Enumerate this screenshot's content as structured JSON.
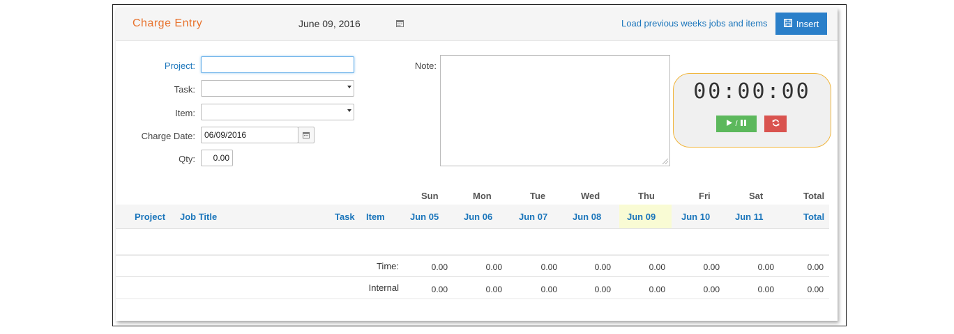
{
  "header": {
    "title": "Charge Entry",
    "date": "June 09, 2016",
    "load_link": "Load previous weeks jobs and items",
    "insert_label": "Insert"
  },
  "form": {
    "project_label": "Project:",
    "project_value": "",
    "task_label": "Task:",
    "task_value": "",
    "item_label": "Item:",
    "item_value": "",
    "charge_date_label": "Charge Date:",
    "charge_date_value": "06/09/2016",
    "qty_label": "Qty:",
    "qty_value": "0.00",
    "note_label": "Note:",
    "note_value": ""
  },
  "timer": {
    "display": "00:00:00",
    "play_pause_label": "/"
  },
  "grid": {
    "days": [
      "Sun",
      "Mon",
      "Tue",
      "Wed",
      "Thu",
      "Fri",
      "Sat"
    ],
    "total_day_label": "Total",
    "columns": {
      "project": "Project",
      "job_title": "Job Title",
      "task": "Task",
      "item": "Item",
      "dates": [
        "Jun 05",
        "Jun 06",
        "Jun 07",
        "Jun 08",
        "Jun 09",
        "Jun 10",
        "Jun 11"
      ],
      "total": "Total"
    },
    "highlighted_day": "Jun 09",
    "totals": [
      {
        "label": "Time:",
        "values": [
          "0.00",
          "0.00",
          "0.00",
          "0.00",
          "0.00",
          "0.00",
          "0.00",
          "0.00"
        ]
      },
      {
        "label": "Internal",
        "values": [
          "0.00",
          "0.00",
          "0.00",
          "0.00",
          "0.00",
          "0.00",
          "0.00",
          "0.00"
        ]
      }
    ]
  },
  "colors": {
    "title_orange": "#e8722c",
    "link_blue": "#1a75bb",
    "insert_blue": "#2a7fc9",
    "timer_border": "#f1b53a",
    "play_green": "#5cb85c",
    "reset_red": "#d9534f",
    "today_highlight": "#f9fbd4"
  },
  "icons": [
    "calendar-icon",
    "save-icon",
    "play-icon",
    "pause-icon",
    "refresh-icon",
    "dropdown-arrow-icon",
    "resize-grip-icon"
  ]
}
